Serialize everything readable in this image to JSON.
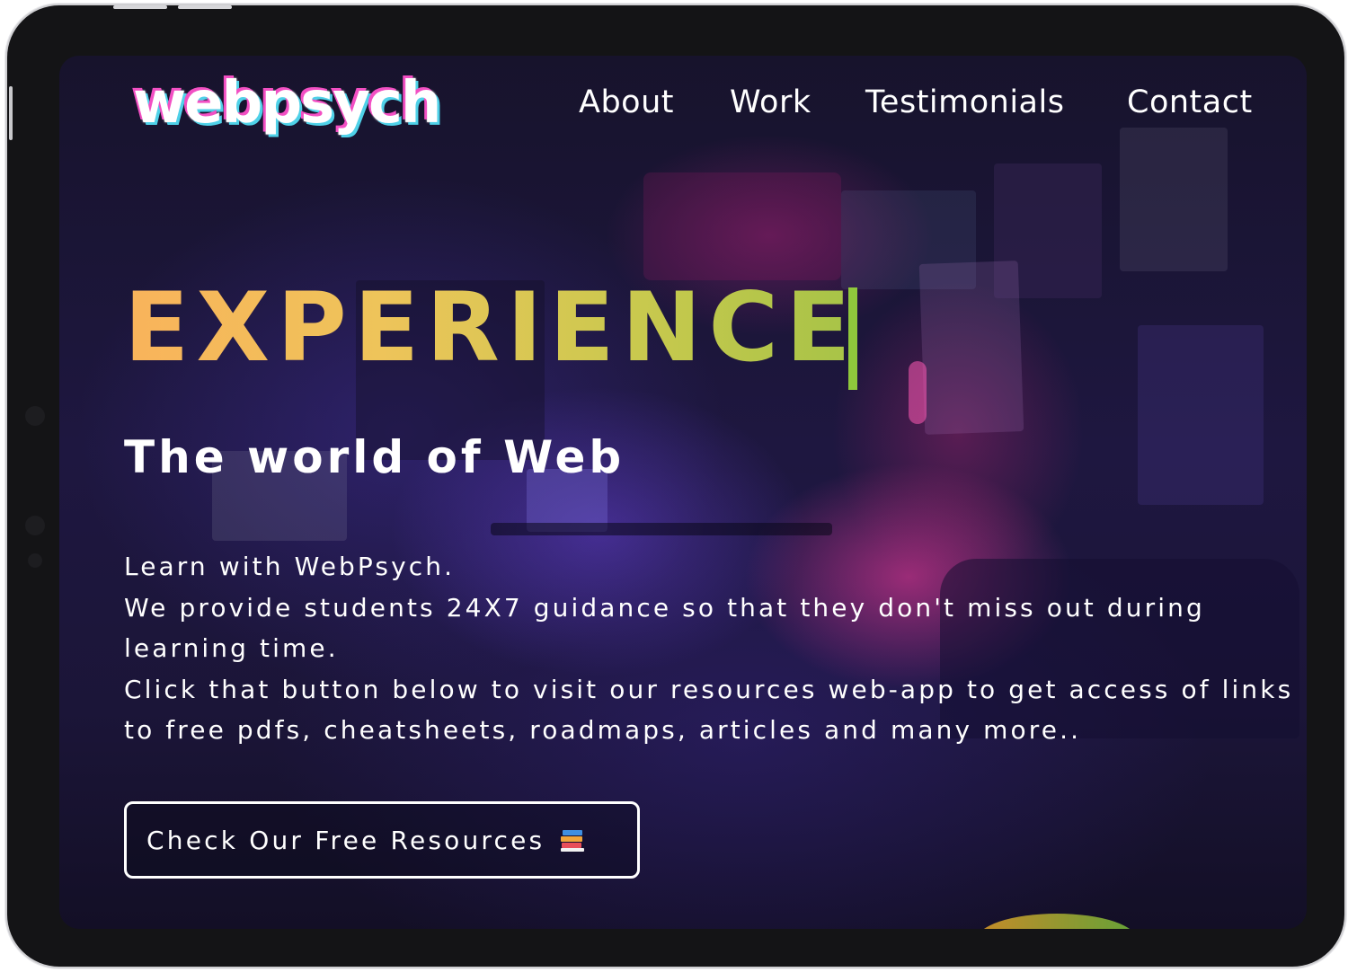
{
  "header": {
    "logo_text": "webpsych",
    "nav": [
      {
        "label": "About"
      },
      {
        "label": "Work"
      },
      {
        "label": "Testimonials"
      },
      {
        "label": "Contact"
      }
    ]
  },
  "hero": {
    "headline": "EXPERIENCE",
    "subheadline": "The world of Web",
    "body_lines": [
      "Learn with WebPsych.",
      "We provide students 24X7 guidance so that they don't miss out during learning time.",
      "Click that button below to visit our resources web-app to get access of links to free pdfs, cheatsheets, roadmaps, articles and many more.."
    ],
    "cta": {
      "label": "Check Our Free Resources",
      "icon": "books-icon"
    }
  },
  "colors": {
    "headline_gradient_start": "#f9b35b",
    "headline_gradient_end": "#a6c347",
    "cursor": "#8fc83c",
    "logo_shadow_pink": "#f24fc3",
    "logo_shadow_cyan": "#4fd1e8",
    "text": "#ffffff"
  }
}
